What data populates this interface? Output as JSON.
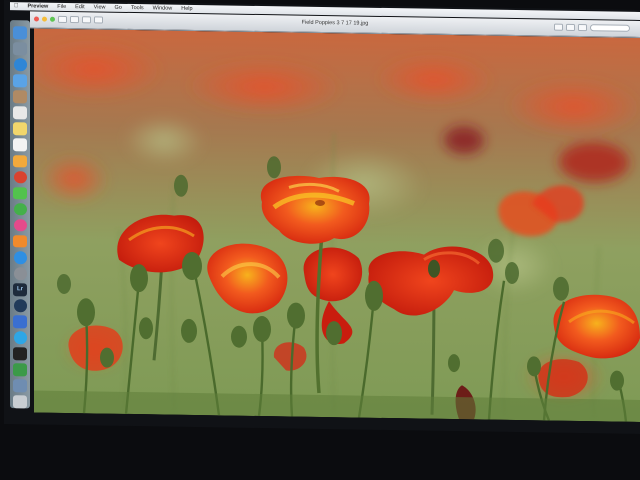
{
  "menubar": {
    "items": [
      "Preview",
      "File",
      "Edit",
      "View",
      "Go",
      "Tools",
      "Window",
      "Help"
    ]
  },
  "window": {
    "title": "Field Poppies 3 7 17 19.jpg"
  },
  "dock": {
    "icons": [
      {
        "name": "finder-icon",
        "color": "#4a8fd8"
      },
      {
        "name": "launchpad-icon",
        "color": "#7b8ea0"
      },
      {
        "name": "safari-icon",
        "color": "#2f86d6"
      },
      {
        "name": "mail-icon",
        "color": "#5aa3e6"
      },
      {
        "name": "contacts-icon",
        "color": "#b08a64"
      },
      {
        "name": "calendar-icon",
        "color": "#e8e8e8"
      },
      {
        "name": "notes-icon",
        "color": "#f1d66c"
      },
      {
        "name": "reminders-icon",
        "color": "#f3f3f3"
      },
      {
        "name": "photos-icon",
        "color": "#f2a93b"
      },
      {
        "name": "chrome-icon",
        "color": "#d9432f"
      },
      {
        "name": "messages-icon",
        "color": "#52c24d"
      },
      {
        "name": "facetime-icon",
        "color": "#44b04a"
      },
      {
        "name": "itunes-icon",
        "color": "#e44a8b"
      },
      {
        "name": "ibooks-icon",
        "color": "#f08a2c"
      },
      {
        "name": "appstore-icon",
        "color": "#2f8fe3"
      },
      {
        "name": "system-preferences-icon",
        "color": "#8a8f96"
      },
      {
        "name": "lightroom-icon",
        "color": "#1e2b3c"
      },
      {
        "name": "steam-icon",
        "color": "#213a5a"
      },
      {
        "name": "dropbox-icon",
        "color": "#3a6fd0"
      },
      {
        "name": "skype-icon",
        "color": "#2ea6e6"
      },
      {
        "name": "terminal-icon",
        "color": "#222"
      },
      {
        "name": "activity-monitor-icon",
        "color": "#3b9a48"
      },
      {
        "name": "preview-icon",
        "color": "#6f8db1"
      },
      {
        "name": "trash-icon",
        "color": "#c8cdd2"
      }
    ],
    "lightroom_label": "Lr"
  },
  "colors": {
    "poppy_red": "#e8391a",
    "poppy_orange": "#f25a1e",
    "poppy_yellow": "#f7b21d",
    "stem_green": "#4e6b31",
    "background_green": "#8da05a"
  }
}
